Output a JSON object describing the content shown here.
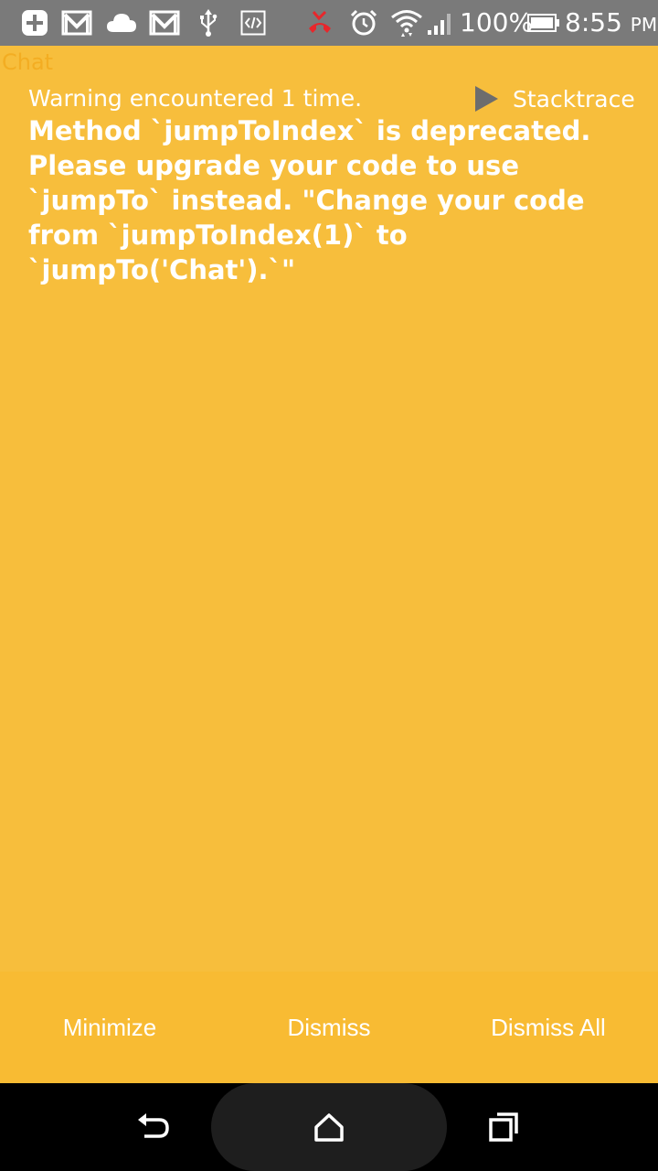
{
  "status_bar": {
    "left_icons": [
      "add-icon",
      "gmail-icon",
      "cloud-icon",
      "gmail-icon",
      "usb-icon",
      "code-icon"
    ],
    "right_icons": [
      "missed-call-icon",
      "alarm-icon",
      "wifi-icon",
      "signal-icon",
      "battery-icon"
    ],
    "battery_percent": "100%",
    "time": "8:55",
    "ampm": "PM"
  },
  "app": {
    "title": "Chat"
  },
  "warning": {
    "count_text": "Warning encountered 1 time.",
    "stacktrace_label": "Stacktrace",
    "message": "Method `jumpToIndex` is deprecated. Please upgrade your code to use `jumpTo` instead. \"Change your code from `jumpToIndex(1)` to `jumpTo('Chat').`\""
  },
  "actions": {
    "minimize": "Minimize",
    "dismiss": "Dismiss",
    "dismiss_all": "Dismiss All"
  },
  "nav_bar": {
    "buttons": [
      "back-icon",
      "home-icon",
      "recents-icon"
    ]
  },
  "colors": {
    "warning_background": "#f7be3c",
    "action_bar_background": "#f8bb33",
    "status_bar_background": "#7a7a7a",
    "nav_bar_background": "#000000",
    "missed_call_accent": "#e8262b"
  }
}
